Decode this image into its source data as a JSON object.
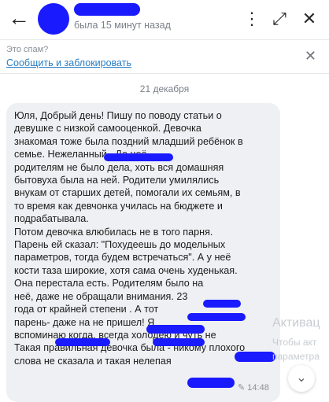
{
  "header": {
    "status": "была 15 минут назад",
    "back_icon": "←",
    "close_icon": "✕",
    "expand_icon": "⤢",
    "more_icon": "⋮"
  },
  "spam_banner": {
    "question": "Это спам?",
    "action": "Сообщить и заблокировать",
    "close_icon": "✕"
  },
  "chat": {
    "date_divider": "21 декабря",
    "message_text": "Юля, Добрый день! Пишу по поводу статьи о\nдевушке с низкой самооценкой. Девочка\nзнакомая тоже была поздний младший ребёнок в\nсемье. Нежеланный                    . До неё\nродителям не было дела, хоть вся домашняя\nбытовуха была на ней. Родители умилялись\nвнукам от старших детей, помогали их семьям, в\nто время как девчонка училась на бюджете и\nподрабатывала.\nПотом девочка влюбилась не в того парня.\nПарень ей сказал: \"Похудеешь до модельных\nпараметров, тогда будем встречаться\". А у неё\nкости таза широкие, хотя сама очень худенькая.\nОна перестала есть. Родителям было         на\nнеё, даже не обращали внимания.               23\nгода от крайней степени                  . А тот\nпарень-            даже на                  не пришел! Я\nвспоминаю когда, всегда холодею и чуть не       \nТакая правильная девочка была - никому плохого\nслова не сказала и такая нелепая",
    "message_time": "14:48",
    "edit_icon": "✎",
    "scroll_down_icon": "⌄"
  },
  "watermark": {
    "line1": "Активац",
    "line2": "Чтобы акт",
    "line3": "параметра"
  }
}
